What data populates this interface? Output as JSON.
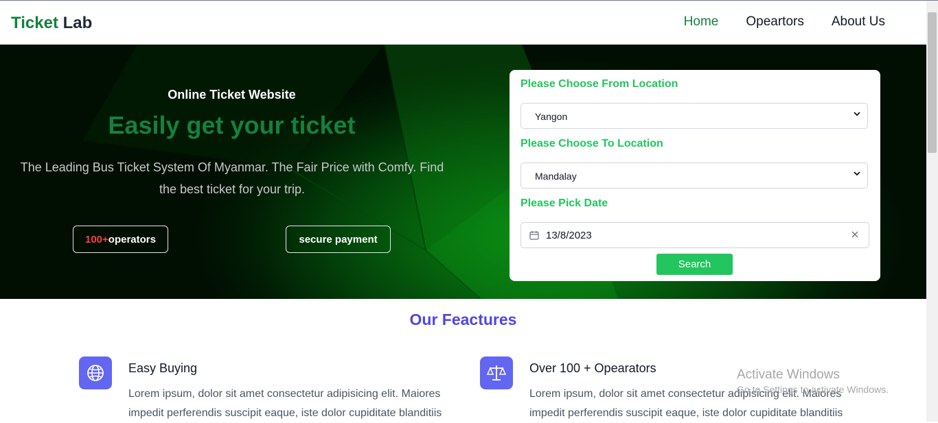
{
  "navbar": {
    "brand_part1": "Ticket",
    "brand_part2": "Lab",
    "links": [
      "Home",
      "Opeartors",
      "About Us"
    ]
  },
  "hero": {
    "kicker": "Online Ticket Website",
    "title": "Easily get your ticket",
    "description": "The Leading Bus Ticket System Of Myanmar. The Fair Price with Comfy. Find the best ticket for your trip.",
    "badge_operators_number": "100+",
    "badge_operators_label": "operators",
    "badge_secure": "secure payment"
  },
  "search": {
    "from_label": "Please Choose From Location",
    "from_value": "Yangon",
    "to_label": "Please Choose To Location",
    "to_value": "Mandalay",
    "date_label": "Please Pick Date",
    "date_value": "13/8/2023",
    "button_label": "Search"
  },
  "features": {
    "title": "Our Feactures",
    "items": [
      {
        "icon": "globe-icon",
        "title": "Easy Buying",
        "text": "Lorem ipsum, dolor sit amet consectetur adipisicing elit. Maiores impedit perferendis suscipit eaque, iste dolor cupiditate blanditiis"
      },
      {
        "icon": "scale-icon",
        "title": "Over 100 + Opearators",
        "text": "Lorem ipsum, dolor sit amet consectetur adipisicing elit. Maiores impedit perferendis suscipit eaque, iste dolor cupiditate blanditiis"
      }
    ]
  },
  "watermark": {
    "line1": "Activate Windows",
    "line2": "Go to Settings to activate Windows."
  },
  "colors": {
    "brand_green": "#15803d",
    "accent_green": "#22c55e",
    "feature_indigo": "#4f46e5",
    "icon_bg": "#6366f1",
    "badge_red": "#ef4444"
  }
}
